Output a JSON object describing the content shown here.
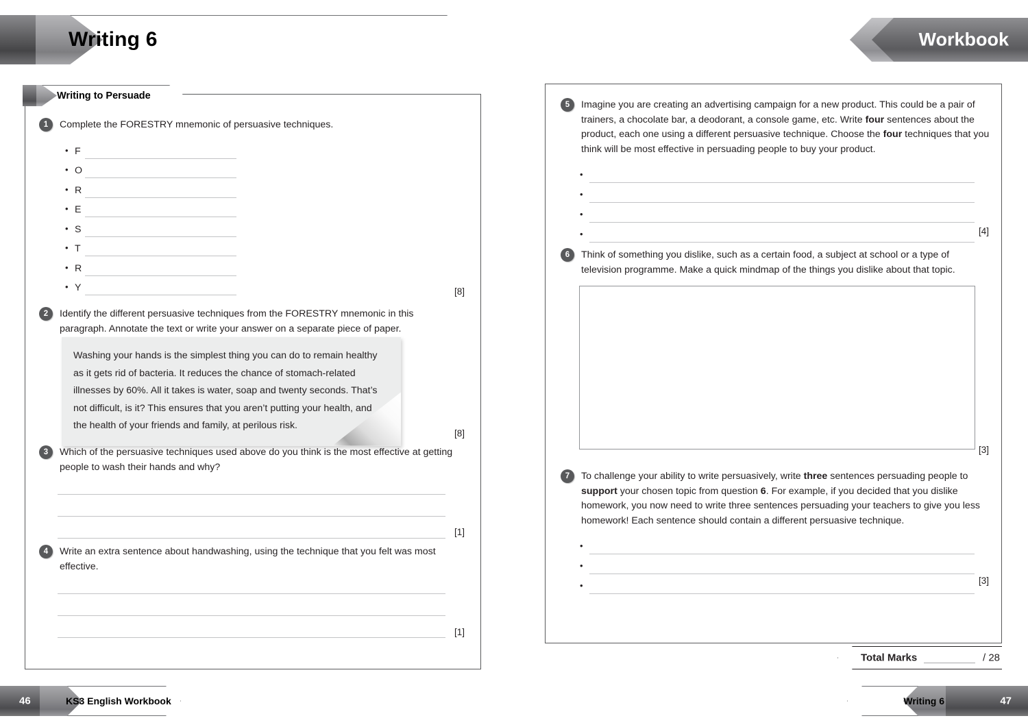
{
  "header": {
    "title": "Writing 6",
    "badge": "Workbook"
  },
  "left_page": {
    "section_title": "Writing to Persuade",
    "questions": [
      {
        "number": "1",
        "text": "Complete the FORESTRY mnemonic of persuasive techniques.",
        "mnemonic_letters": [
          "F",
          "O",
          "R",
          "E",
          "S",
          "T",
          "R",
          "Y"
        ],
        "marks": "[8]"
      },
      {
        "number": "2",
        "text": "Identify the different persuasive techniques from the FORESTRY mnemonic in this paragraph. Annotate the text or write your answer on a separate piece of paper.",
        "passage": "Washing your hands is the simplest thing you can do to remain healthy as it gets rid of bacteria. It reduces the chance of stomach-related illnesses by 60%. All it takes is water, soap and twenty seconds. That’s not difficult, is it? This ensures that you aren’t putting your health, and the health of your friends and family, at perilous risk.",
        "marks": "[8]"
      },
      {
        "number": "3",
        "text": "Which of the persuasive techniques used above do you think is the most effective at getting people to wash their hands and why?",
        "answer_lines": 3,
        "marks": "[1]"
      },
      {
        "number": "4",
        "text": "Write an extra sentence about handwashing, using the technique that you felt was most effective.",
        "answer_lines": 3,
        "marks": "[1]"
      }
    ]
  },
  "right_page": {
    "questions": [
      {
        "number": "5",
        "text_parts": [
          {
            "t": "Imagine you are creating an advertising campaign for a new product. This could be a pair of trainers, a chocolate bar, a deodorant, a console game, etc. Write ",
            "bold": false
          },
          {
            "t": "four",
            "bold": true
          },
          {
            "t": " sentences about the product, each one using a different persuasive technique. Choose the ",
            "bold": false
          },
          {
            "t": "four",
            "bold": true
          },
          {
            "t": " techniques that you think will be most effective in persuading people to buy your product.",
            "bold": false
          }
        ],
        "bullet_lines": 4,
        "marks": "[4]"
      },
      {
        "number": "6",
        "text_parts": [
          {
            "t": "Think of something you dislike, such as a certain food, a subject at school or a type of television programme. Make a quick mindmap of the things you dislike about that topic.",
            "bold": false
          }
        ],
        "mindmap_box": true,
        "marks": "[3]"
      },
      {
        "number": "7",
        "text_parts": [
          {
            "t": "To challenge your ability to write persuasively, write ",
            "bold": false
          },
          {
            "t": "three",
            "bold": true
          },
          {
            "t": " sentences persuading people to ",
            "bold": false
          },
          {
            "t": "support",
            "bold": true
          },
          {
            "t": " your chosen topic from question ",
            "bold": false
          },
          {
            "t": "6",
            "bold": true
          },
          {
            "t": ". For example, if you decided that you dislike homework, you now need to write three sentences persuading your teachers to give you less homework! Each sentence should contain a different persuasive technique.",
            "bold": false
          }
        ],
        "bullet_lines": 3,
        "marks": "[3]"
      }
    ],
    "total_marks": {
      "label": "Total Marks",
      "out_of": "/ 28"
    }
  },
  "footer": {
    "left_page_number": "46",
    "left_text": "KS3 English Workbook",
    "right_text": "Writing 6",
    "right_page_number": "47"
  },
  "colors": {
    "ink": "#231f20",
    "chevron_gray": "#58595b",
    "rule_gray": "#c2c3c5",
    "card_bg": "#eceded"
  }
}
